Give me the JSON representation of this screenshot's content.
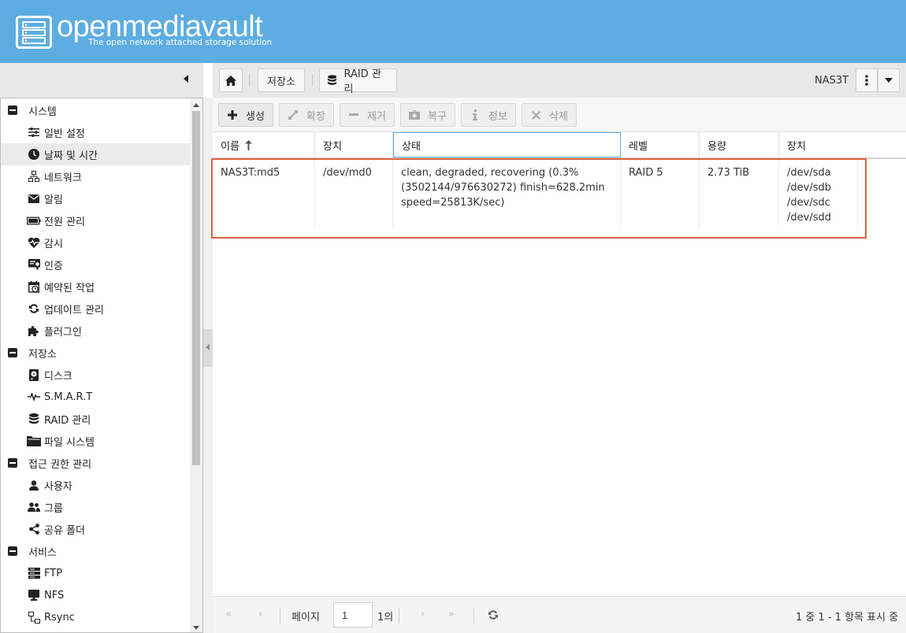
{
  "header": {
    "brand": "openmediavault",
    "tagline": "The open network attached storage solution"
  },
  "breadcrumb": {
    "storage": "저장소",
    "raid": "RAID 관리"
  },
  "hostname": "NAS3T",
  "sidebar": {
    "groups": [
      {
        "label": "시스템",
        "items": [
          {
            "label": "일반 설정",
            "icon": "sliders-icon"
          },
          {
            "label": "날짜 및 시간",
            "icon": "clock-icon",
            "active": true
          },
          {
            "label": "네트워크",
            "icon": "network-icon"
          },
          {
            "label": "알림",
            "icon": "envelope-icon"
          },
          {
            "label": "전원 관리",
            "icon": "battery-icon"
          },
          {
            "label": "감시",
            "icon": "heartbeat-icon"
          },
          {
            "label": "인증",
            "icon": "certificate-icon"
          },
          {
            "label": "예약된 작업",
            "icon": "calendar-clock-icon"
          },
          {
            "label": "업데이트 관리",
            "icon": "refresh-icon"
          },
          {
            "label": "플러그인",
            "icon": "puzzle-icon"
          }
        ]
      },
      {
        "label": "저장소",
        "items": [
          {
            "label": "디스크",
            "icon": "harddisk-icon"
          },
          {
            "label": "S.M.A.R.T",
            "icon": "pulse-icon"
          },
          {
            "label": "RAID 관리",
            "icon": "database-icon"
          },
          {
            "label": "파일 시스템",
            "icon": "folder-icon"
          }
        ]
      },
      {
        "label": "접근 권한 관리",
        "items": [
          {
            "label": "사용자",
            "icon": "user-icon"
          },
          {
            "label": "그룹",
            "icon": "users-icon"
          },
          {
            "label": "공유 폴더",
            "icon": "share-icon"
          }
        ]
      },
      {
        "label": "서비스",
        "items": [
          {
            "label": "FTP",
            "icon": "server-icon"
          },
          {
            "label": "NFS",
            "icon": "desktop-icon"
          },
          {
            "label": "Rsync",
            "icon": "sitemap-icon"
          }
        ]
      }
    ]
  },
  "toolbar": {
    "create": "생성",
    "grow": "확장",
    "remove": "제거",
    "recover": "복구",
    "details": "정보",
    "delete": "삭제"
  },
  "grid": {
    "columns": [
      "이름",
      "장치",
      "상태",
      "레벨",
      "용량",
      "장치"
    ],
    "rows": [
      {
        "name": "NAS3T:md5",
        "device": "/dev/md0",
        "state": "clean, degraded, recovering (0.3% (3502144/976630272) finish=628.2min speed=25813K/sec)",
        "level": "RAID 5",
        "capacity": "2.73 TiB",
        "devices": [
          "/dev/sda",
          "/dev/sdb",
          "/dev/sdc",
          "/dev/sdd"
        ]
      }
    ]
  },
  "pager": {
    "page_label": "페이지",
    "page_value": "1",
    "of_label": "1의",
    "summary": "1 중 1 - 1 항목 표시 중"
  },
  "colors": {
    "header_bg": "#5dade2",
    "highlight": "#e0613f"
  }
}
